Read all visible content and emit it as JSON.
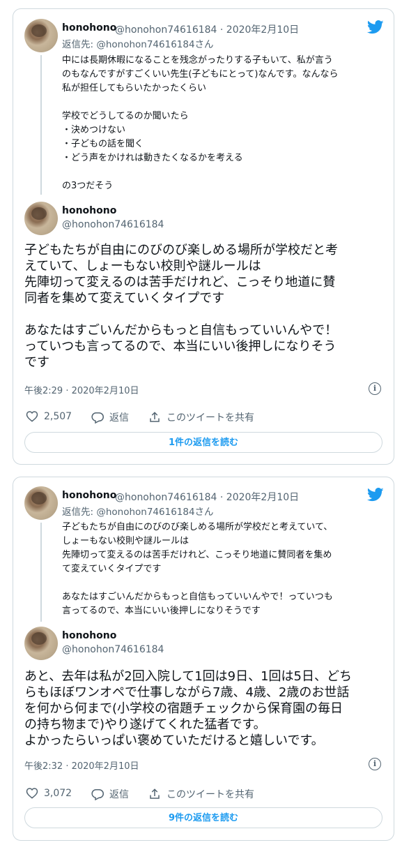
{
  "colors": {
    "accent": "#1d9bf0",
    "border": "#cfd9de",
    "muted": "#536471",
    "text": "#0f1419"
  },
  "tweets": [
    {
      "parent": {
        "name": "honohono",
        "handle_date": "@honohon74616184 · 2020年2月10日",
        "reply_prefix": "返信先: ",
        "reply_handle": "@honohon74616184さん",
        "text": "中には長期休暇になることを残念がったりする子もいて、私が言う\nのもなんですがすごくいい先生(子どもにとって)なんです。なんなら\n私が担任してもらいたかったくらい\n\n学校でどうしてるのか聞いたら\n・決めつけない\n・子どもの話を聞く\n・どう声をかけれは動きたくなるかを考える\n\nの3つだそう"
      },
      "main": {
        "name": "honohono",
        "handle": "@honohon74616184",
        "text": "子どもたちが自由にのびのび楽しめる場所が学校だと考\nえていて、しょーもない校則や謎ルールは\n先陣切って変えるのは苦手だけれど、こっそり地道に賛\n同者を集めて変えていくタイプです\n\nあなたはすごいんだからもっと自信もっていいんやで！\nっていつも言ってるので、本当にいい後押しになりそう\nです",
        "timestamp": "午後2:29 · 2020年2月10日",
        "likes": "2,507",
        "reply_label": "返信",
        "share_label": "このツイートを共有",
        "replies_button": "1件の返信を読む"
      }
    },
    {
      "parent": {
        "name": "honohono",
        "handle_date": "@honohon74616184 · 2020年2月10日",
        "reply_prefix": "返信先: ",
        "reply_handle": "@honohon74616184さん",
        "text": "子どもたちが自由にのびのび楽しめる場所が学校だと考えていて、\nしょーもない校則や謎ルールは\n先陣切って変えるのは苦手だけれど、こっそり地道に賛同者を集め\nて変えていくタイプです\n\nあなたはすごいんだからもっと自信もっていいんやで！っていつも\n言ってるので、本当にいい後押しになりそうです"
      },
      "main": {
        "name": "honohono",
        "handle": "@honohon74616184",
        "text": "あと、去年は私が2回入院して1回は9日、1回は5日、どち\nらもほぼワンオペで仕事しながら7歳、4歳、2歳のお世話\nを何から何まで(小学校の宿題チェックから保育園の毎日\nの持ち物まで)やり遂げてくれた猛者です。\nよかったらいっぱい褒めていただけると嬉しいです。",
        "timestamp": "午後2:32 · 2020年2月10日",
        "likes": "3,072",
        "reply_label": "返信",
        "share_label": "このツイートを共有",
        "replies_button": "9件の返信を読む"
      }
    }
  ]
}
